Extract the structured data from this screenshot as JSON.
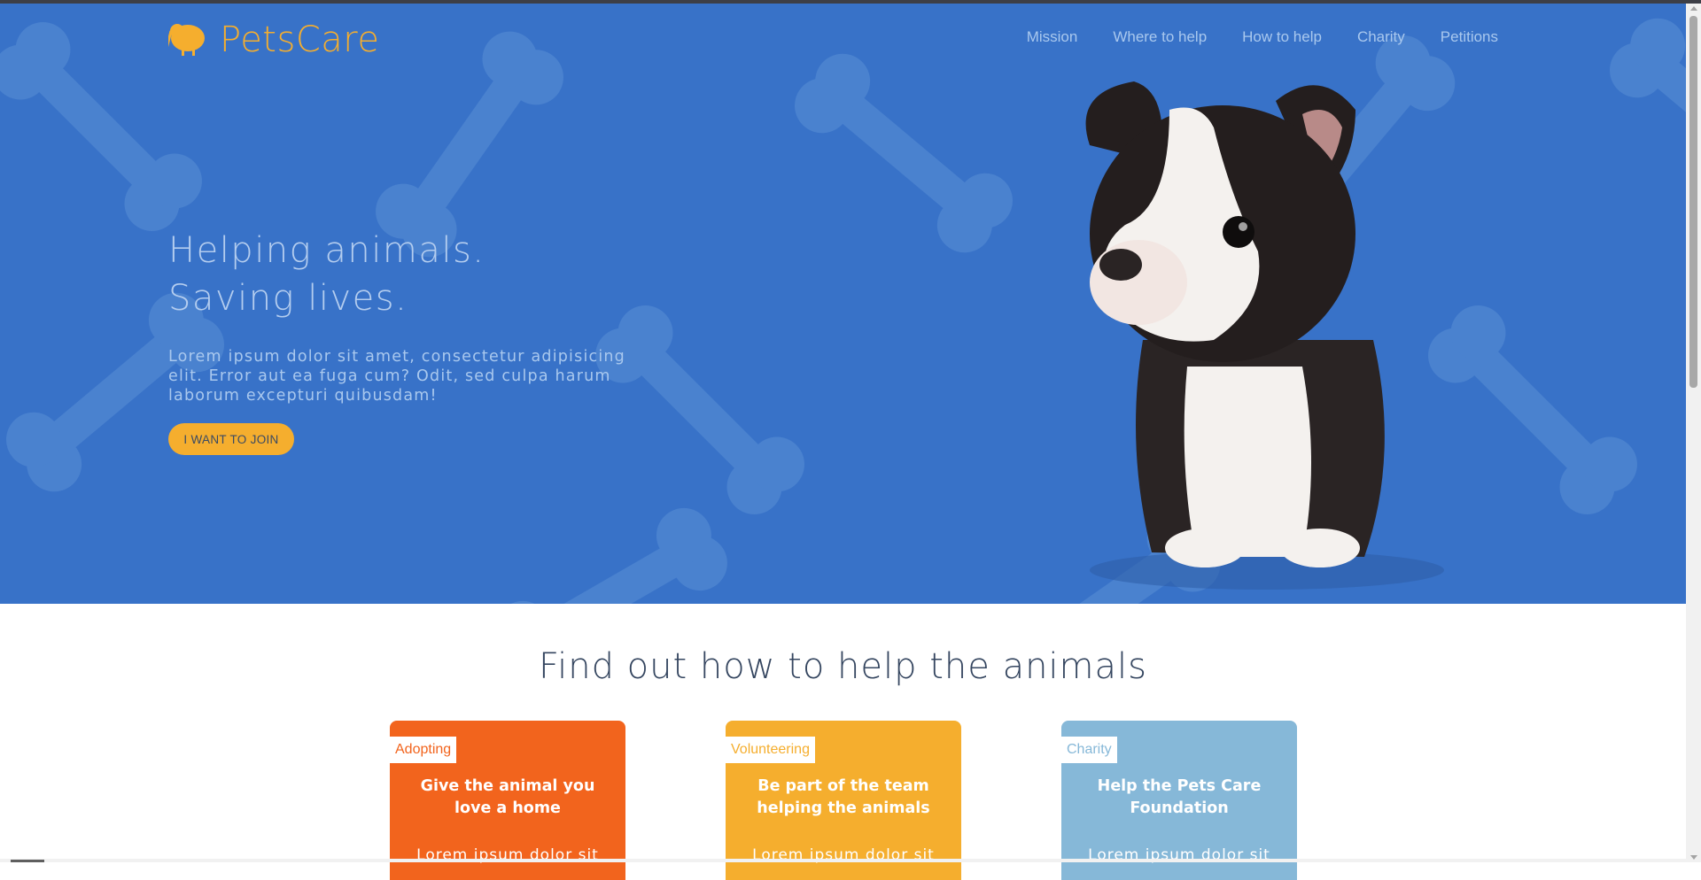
{
  "brand": {
    "name": "PetsCare",
    "logo_icon": "kiwi-icon"
  },
  "nav": {
    "items": [
      {
        "label": "Mission"
      },
      {
        "label": "Where to help"
      },
      {
        "label": "How to help"
      },
      {
        "label": "Charity"
      },
      {
        "label": "Petitions"
      }
    ]
  },
  "hero": {
    "title_line1": "Helping animals.",
    "title_line2": "Saving lives.",
    "text": "Lorem ipsum dolor sit amet, consectetur adipisicing elit. Error aut ea fuga cum? Odit, sed culpa harum laborum excepturi quibusdam!",
    "cta_label": "I WANT TO JOIN"
  },
  "section": {
    "title": "Find out how to help the animals"
  },
  "cards": [
    {
      "tag": "Adopting",
      "title": "Give the animal you love a home",
      "body": "Lorem ipsum dolor sit"
    },
    {
      "tag": "Volunteering",
      "title": "Be part of the team helping the animals",
      "body": "Lorem ipsum dolor sit"
    },
    {
      "tag": "Charity",
      "title": "Help the Pets Care Foundation",
      "body": "Lorem ipsum dolor sit"
    }
  ],
  "colors": {
    "hero_bg": "#3872c8",
    "accent": "#f5ae2e",
    "card_adopting": "#f2641d",
    "card_volunteering": "#f5ae2e",
    "card_charity": "#86b8d8"
  }
}
